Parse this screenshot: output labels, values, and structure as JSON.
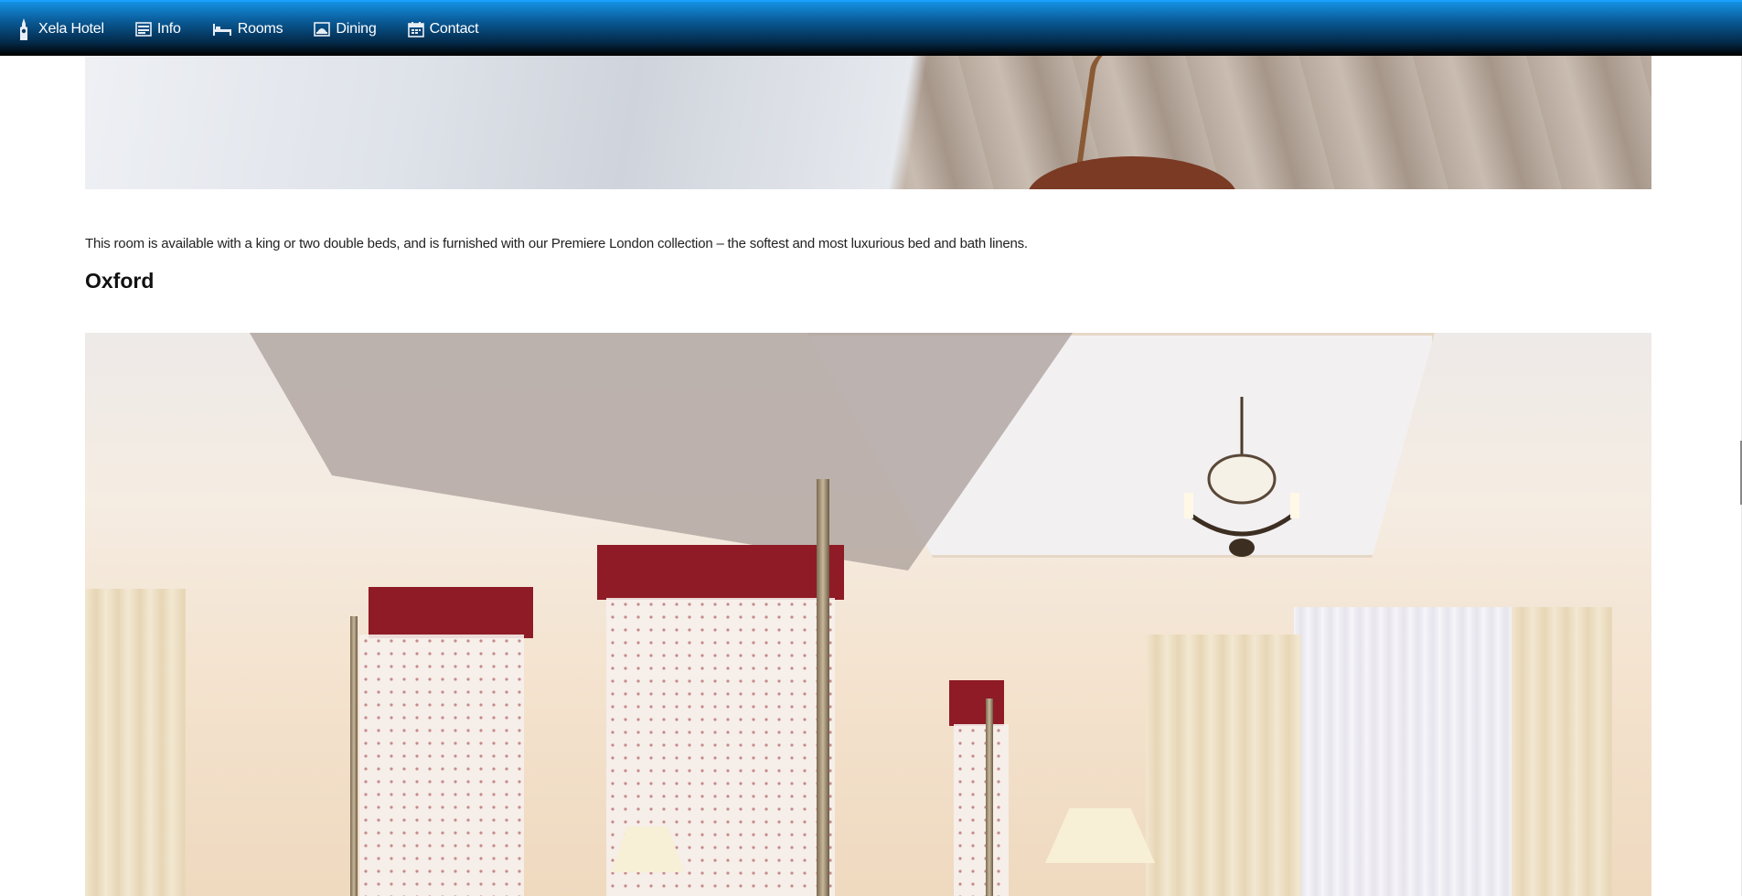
{
  "nav": {
    "brand": "Xela Hotel",
    "items": [
      {
        "label": "Info",
        "icon": "info-icon"
      },
      {
        "label": "Rooms",
        "icon": "bed-icon"
      },
      {
        "label": "Dining",
        "icon": "dining-icon"
      },
      {
        "label": "Contact",
        "icon": "calendar-icon"
      }
    ]
  },
  "content": {
    "room_description": "This room is available with a king or two double beds, and is furnished with our Premiere London collection – the softest and most luxurious bed and bath linens.",
    "room_title": "Oxford"
  },
  "colors": {
    "nav_top": "#1591e4",
    "nav_bottom": "#000000",
    "text": "#222222"
  }
}
